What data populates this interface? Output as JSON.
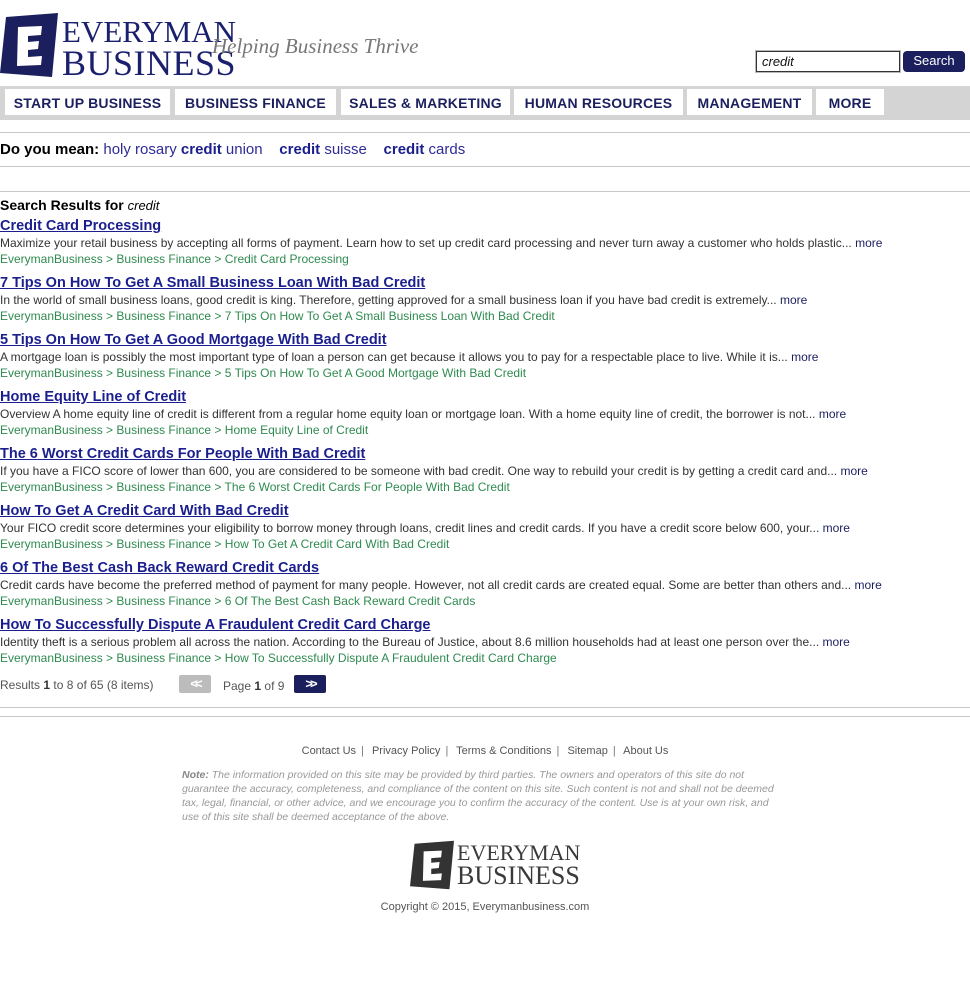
{
  "brand": {
    "name_line1": "EVERYMAN",
    "name_line2": "BUSINESS",
    "tagline": "Helping Business Thrive",
    "color": "#1b1f5e"
  },
  "search": {
    "value": "credit",
    "button_label": "Search"
  },
  "nav": {
    "items": [
      {
        "label": "START UP BUSINESS"
      },
      {
        "label": "BUSINESS FINANCE"
      },
      {
        "label": "SALES & MARKETING"
      },
      {
        "label": "HUMAN RESOURCES"
      },
      {
        "label": "MANAGEMENT"
      },
      {
        "label": "MORE"
      }
    ]
  },
  "did_you_mean": {
    "label": "Do you mean:",
    "suggestions": [
      {
        "pre": "holy rosary ",
        "bold": "credit",
        "post": " union"
      },
      {
        "pre": "",
        "bold": "credit",
        "post": " suisse"
      },
      {
        "pre": "",
        "bold": "credit",
        "post": " cards"
      }
    ]
  },
  "results": {
    "heading": "Search Results for",
    "query": "credit",
    "more_label": "more",
    "items": [
      {
        "title": "Credit Card Processing",
        "snippet": "Maximize your retail business by accepting all forms of payment. Learn how to set up credit card processing and never turn away a customer who holds plastic...",
        "crumb": "EverymanBusiness > Business Finance > Credit Card Processing"
      },
      {
        "title": "7 Tips On How To Get A Small Business Loan With Bad Credit",
        "snippet": "In the world of small business loans, good credit is king. Therefore, getting approved for a small business loan if you have bad credit is extremely...",
        "crumb": "EverymanBusiness > Business Finance > 7 Tips On How To Get A Small Business Loan With Bad Credit"
      },
      {
        "title": "5 Tips On How To Get A Good Mortgage With Bad Credit",
        "snippet": "A mortgage loan is possibly the most important type of loan a person can get because it allows you to pay for a respectable place to live. While it is...",
        "crumb": "EverymanBusiness > Business Finance > 5 Tips On How To Get A Good Mortgage With Bad Credit"
      },
      {
        "title": "Home Equity Line of Credit",
        "snippet": "Overview A home equity line of credit is different from a regular home equity loan or mortgage loan. With a home equity line of credit, the borrower is not...",
        "crumb": "EverymanBusiness > Business Finance > Home Equity Line of Credit"
      },
      {
        "title": "The 6 Worst Credit Cards For People With Bad Credit",
        "snippet": "If you have a FICO score of lower than 600, you are considered to be someone with bad credit. One way to rebuild your credit is by getting a credit card and...",
        "crumb": "EverymanBusiness > Business Finance > The 6 Worst Credit Cards For People With Bad Credit"
      },
      {
        "title": "How To Get A Credit Card With Bad Credit",
        "snippet": "Your FICO credit score determines your eligibility to borrow money through loans, credit lines and credit cards. If you have a credit score below 600, your...",
        "crumb": "EverymanBusiness > Business Finance > How To Get A Credit Card With Bad Credit"
      },
      {
        "title": "6 Of The Best Cash Back Reward Credit Cards",
        "snippet": "Credit cards have become the preferred method of payment for many people. However, not all credit cards are created equal. Some are better than others and...",
        "crumb": "EverymanBusiness > Business Finance > 6 Of The Best Cash Back Reward Credit Cards"
      },
      {
        "title": "How To Successfully Dispute A Fraudulent Credit Card Charge",
        "snippet": "Identity theft is a serious problem all across the nation. According to the Bureau of Justice, about 8.6 million households had at least one person over the...",
        "crumb": "EverymanBusiness > Business Finance > How To Successfully Dispute A Fraudulent Credit Card Charge"
      }
    ]
  },
  "pager": {
    "results_label": "Results",
    "from": "1",
    "to_label": "to",
    "to": "8",
    "of_label": "of",
    "total": "65",
    "items_label": "(8 items)",
    "page_label": "Page",
    "page": "1",
    "page_of_label": "of",
    "pages": "9",
    "prev_label": "<<",
    "next_label": ">>"
  },
  "footer": {
    "links": [
      "Contact Us",
      "Privacy Policy",
      "Terms & Conditions",
      "Sitemap",
      "About Us"
    ],
    "note_label": "Note:",
    "note_text": "The information provided on this site may be provided by third parties. The owners and operators of this site do not guarantee the accuracy, completeness, and compliance of the content on this site. Such content is not and shall not be deemed tax, legal, financial, or other advice, and we encourage you to confirm the accuracy of the content. Use is at your own risk, and use of this site shall be deemed acceptance of the above.",
    "copyright": "Copyright © 2015, Everymanbusiness.com"
  }
}
